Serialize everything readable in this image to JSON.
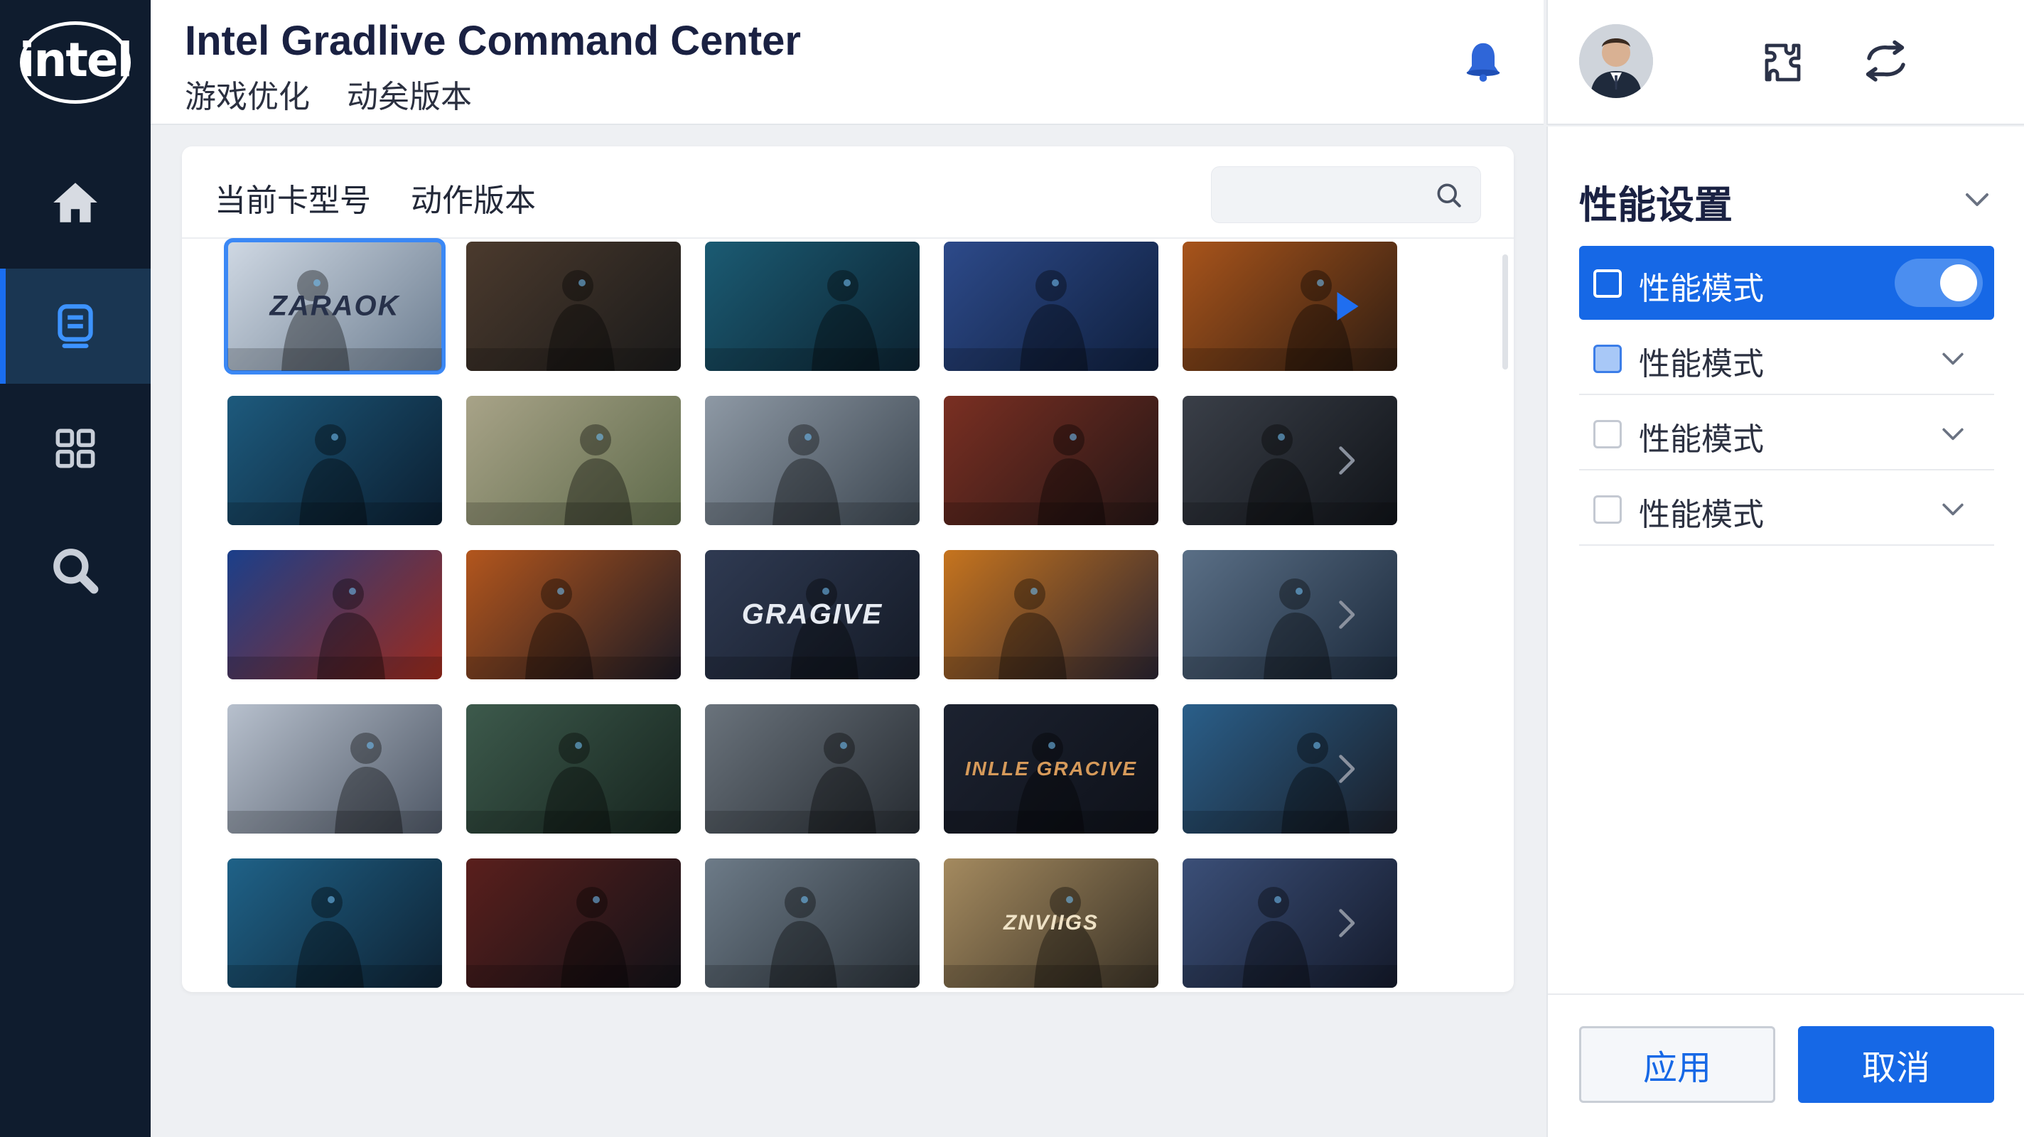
{
  "brand": {
    "logo_text": "intel"
  },
  "header": {
    "title": "Intel Gradlive Command Center",
    "subtitle": [
      "游戏优化",
      "动矣版本"
    ]
  },
  "panel": {
    "tabs": [
      "当前卡型号",
      "动作版本"
    ],
    "search_placeholder": ""
  },
  "tiles": [
    {
      "label": "ZARAOK",
      "colors": [
        "#cfd8e3",
        "#6c7d90"
      ],
      "label_color": "#27314a",
      "label_size": 40,
      "selected": true
    },
    {
      "label": "",
      "colors": [
        "#4b3a2d",
        "#1a1a1a"
      ]
    },
    {
      "label": "",
      "colors": [
        "#1b5b73",
        "#0c2230"
      ]
    },
    {
      "label": "",
      "colors": [
        "#2d4a8a",
        "#0f1f3d"
      ]
    },
    {
      "label": "",
      "colors": [
        "#a8541b",
        "#2f1d12"
      ]
    },
    {
      "label": "",
      "colors": [
        "#1d5a7d",
        "#0b1e30"
      ]
    },
    {
      "label": "",
      "colors": [
        "#a8a388",
        "#5e6a4a"
      ]
    },
    {
      "label": "",
      "colors": [
        "#8e99a5",
        "#3c4650"
      ]
    },
    {
      "label": "",
      "colors": [
        "#7a2f22",
        "#241616"
      ]
    },
    {
      "label": "",
      "colors": [
        "#3a3f48",
        "#101318"
      ]
    },
    {
      "label": "",
      "colors": [
        "#1b3f8a",
        "#9c2a1c"
      ]
    },
    {
      "label": "",
      "colors": [
        "#b3561d",
        "#1c1a24"
      ]
    },
    {
      "label": "GRAGIVE",
      "colors": [
        "#2f3a52",
        "#141a26"
      ],
      "label_color": "#e7ebf2",
      "label_size": 40
    },
    {
      "label": "",
      "colors": [
        "#c6741e",
        "#2a2431"
      ]
    },
    {
      "label": "",
      "colors": [
        "#5a6f86",
        "#1c2a3c"
      ]
    },
    {
      "label": "",
      "colors": [
        "#b7c0cd",
        "#4e5765"
      ]
    },
    {
      "label": "",
      "colors": [
        "#3d5a4c",
        "#16241e"
      ]
    },
    {
      "label": "",
      "colors": [
        "#6a737c",
        "#262b31"
      ]
    },
    {
      "label": "INLLE GRACIVE",
      "colors": [
        "#1c2230",
        "#0e1119"
      ],
      "label_color": "#d69a5a",
      "label_size": 28
    },
    {
      "label": "",
      "colors": [
        "#2a5f8a",
        "#1a1e28"
      ]
    },
    {
      "label": "",
      "colors": [
        "#1f6288",
        "#0e2233"
      ]
    },
    {
      "label": "",
      "colors": [
        "#5a1f1c",
        "#121218"
      ]
    },
    {
      "label": "",
      "colors": [
        "#6d7b88",
        "#2a3138"
      ]
    },
    {
      "label": "ZNVIIGS",
      "colors": [
        "#a48a5f",
        "#3a3226"
      ],
      "label_color": "#efe2c6",
      "label_size": 30
    },
    {
      "label": "",
      "colors": [
        "#3b4f78",
        "#141a2b"
      ]
    }
  ],
  "settings": {
    "title": "性能设置",
    "options": [
      {
        "label": "性能模式",
        "active": true,
        "toggle_on": true
      },
      {
        "label": "性能模式",
        "active": false,
        "checked": true
      },
      {
        "label": "性能模式",
        "active": false
      },
      {
        "label": "性能模式",
        "active": false
      }
    ],
    "apply_label": "应用",
    "cancel_label": "取消"
  },
  "colors": {
    "sidebar_bg": "#0f1c2e",
    "accent": "#1668e6",
    "title_text": "#1a2142"
  }
}
